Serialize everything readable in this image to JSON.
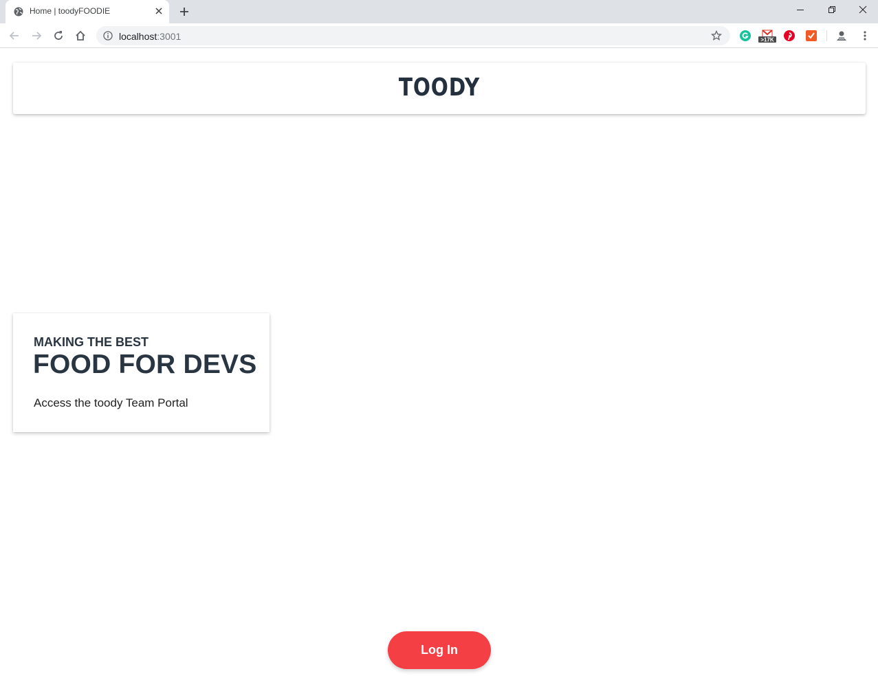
{
  "browser": {
    "tab_title": "Home | toodyFOODIE",
    "url_host": "localhost",
    "url_port": ":3001",
    "gmail_badge": ">17K",
    "icons": {
      "favicon": "globe-icon",
      "tab_close": "close-icon",
      "new_tab": "plus-icon",
      "back": "arrow-left-icon",
      "forward": "arrow-right-icon",
      "reload": "reload-icon",
      "home": "home-icon",
      "site_info": "info-icon",
      "bookmark": "star-icon",
      "menu": "kebab-menu-icon"
    },
    "extensions": [
      "grammarly",
      "gmail-checker",
      "pinterest",
      "todoist",
      "profile"
    ]
  },
  "header": {
    "logo": "TOODY"
  },
  "hero": {
    "kicker": "MAKING THE BEST",
    "title": "FOOD FOR DEVS",
    "subtitle": "Access the toody Team Portal"
  },
  "actions": {
    "login_label": "Log In"
  },
  "colors": {
    "accent": "#f43f45",
    "heading": "#2a3542",
    "chrome_bg": "#dee1e6"
  }
}
